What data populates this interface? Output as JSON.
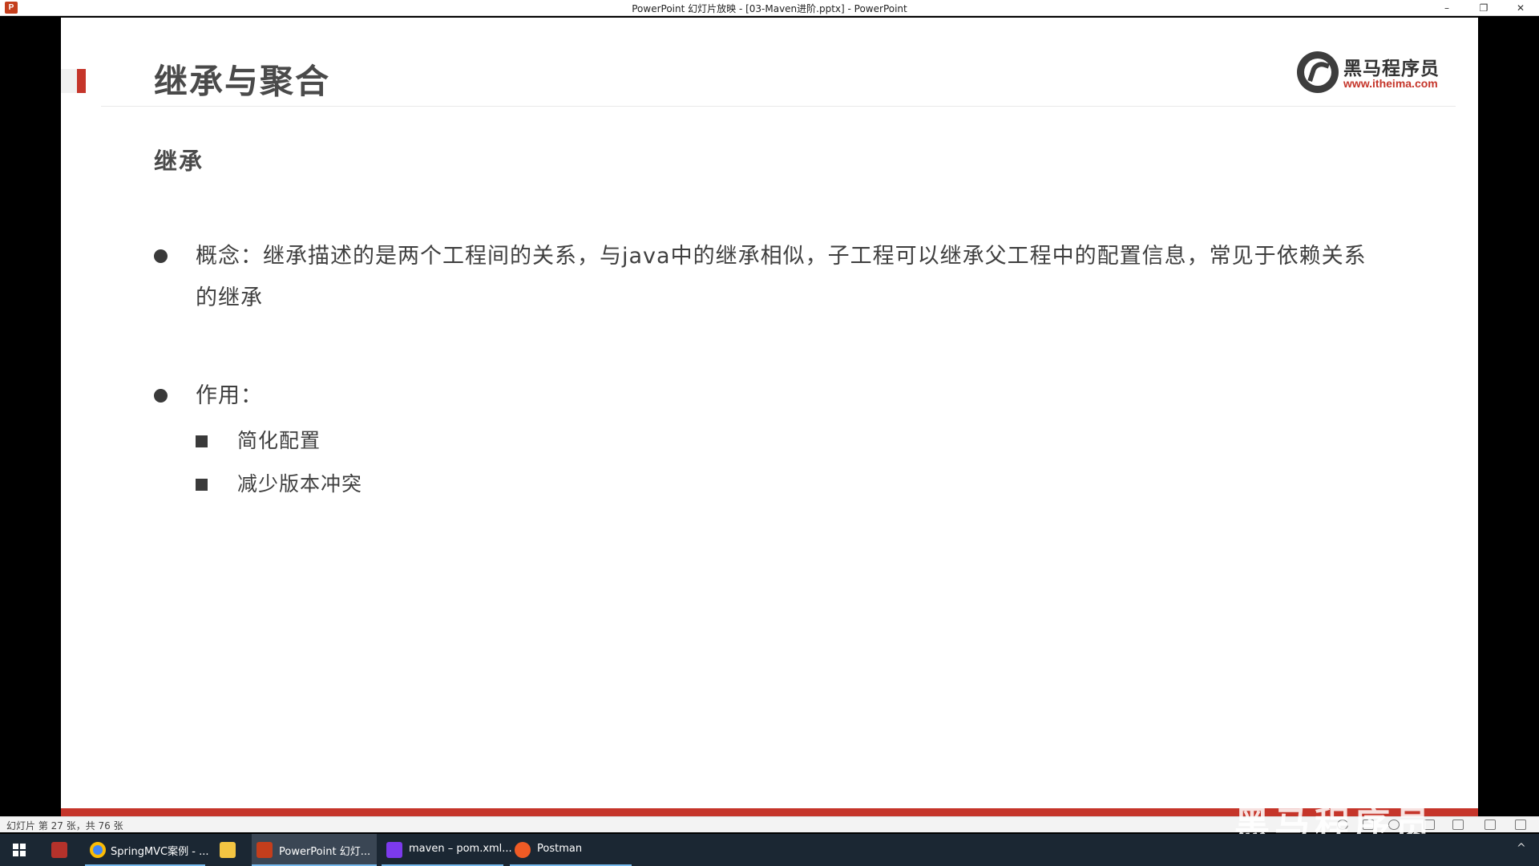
{
  "window": {
    "title": "PowerPoint 幻灯片放映 - [03-Maven进阶.pptx] - PowerPoint",
    "app_icon_letter": "P",
    "min_glyph": "–",
    "max_glyph": "❐",
    "close_glyph": "✕"
  },
  "slide": {
    "title": "继承与聚合",
    "logo": {
      "brand": "黑马程序员",
      "url": "www.itheima.com"
    },
    "section_heading": "继承",
    "bullets": [
      {
        "text": "概念：继承描述的是两个工程间的关系，与java中的继承相似，子工程可以继承父工程中的配置信息，常见于依赖关系的继承"
      },
      {
        "text": "作用："
      }
    ],
    "sub_bullets": [
      {
        "text": "简化配置"
      },
      {
        "text": "减少版本冲突"
      }
    ],
    "accent_color": "#c5352a"
  },
  "status_bar": {
    "slide_count": "幻灯片 第 27 张，共 76 张",
    "watermark": "黑马程序员"
  },
  "taskbar": {
    "items": [
      {
        "label": "SpringMVC案例 - ...",
        "icon": "chrome-icon"
      },
      {
        "label": "",
        "icon": "file-explorer-icon"
      },
      {
        "label": "PowerPoint 幻灯...",
        "icon": "powerpoint-icon"
      },
      {
        "label": "maven – pom.xml...",
        "icon": "intellij-icon"
      },
      {
        "label": "Postman",
        "icon": "postman-icon"
      }
    ],
    "tray_glyph": "^"
  }
}
